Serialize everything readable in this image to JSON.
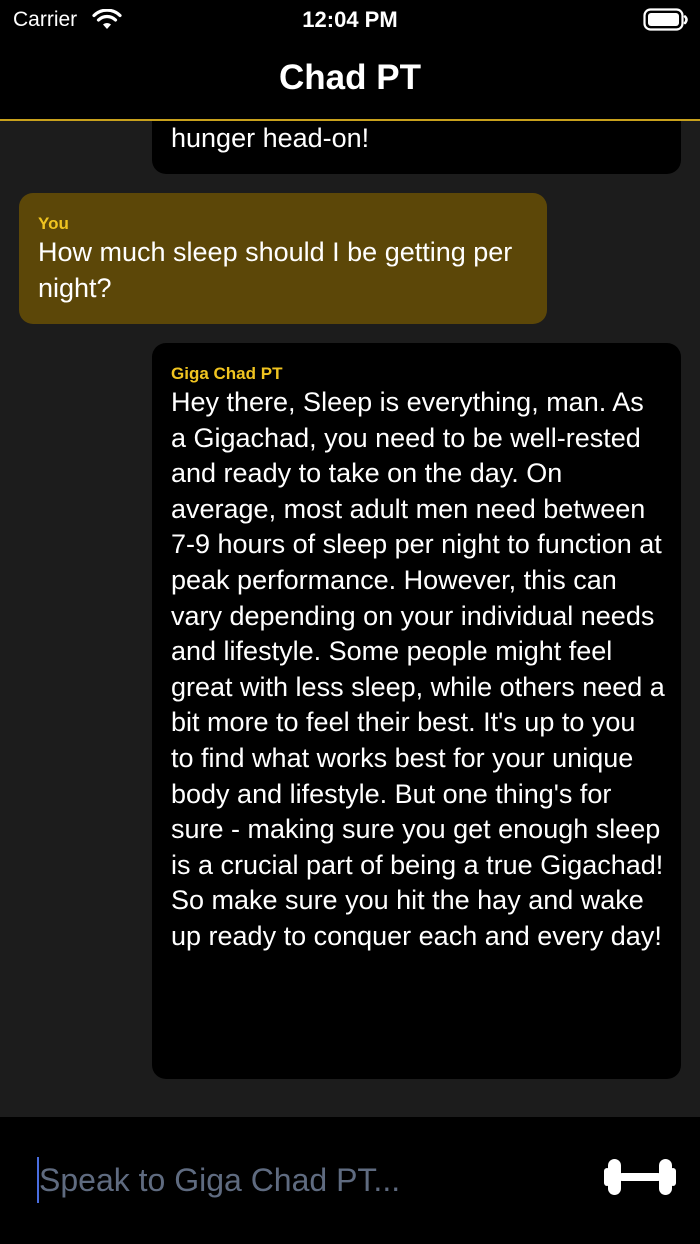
{
  "status_bar": {
    "carrier": "Carrier",
    "time": "12:04 PM",
    "icons": [
      "wifi-icon",
      "battery-icon"
    ]
  },
  "nav": {
    "title": "Chad PT"
  },
  "messages": [
    {
      "sender": "",
      "text": "hunger head-on!",
      "clipped": true
    },
    {
      "sender": "You",
      "text": "How much sleep should I be getting per night?"
    },
    {
      "sender": "Giga Chad PT",
      "text": "Hey there, Sleep is everything, man. As a Gigachad, you need to be well-rested and ready to take on the day. On average, most adult men need between 7-9 hours of sleep per night to function at peak performance. However, this can vary depending on your individual needs and lifestyle. Some people might feel great with less sleep, while others need a bit more to feel their best. It's up to you to find what works best for your unique body and lifestyle. But one thing's for sure - making sure you get enough sleep is a crucial part of being a true Gigachad! So make sure you hit the hay and wake up ready to conquer each and every day!"
    }
  ],
  "input": {
    "placeholder": "Speak to Giga Chad PT...",
    "value": ""
  },
  "send_button": {
    "icon": "dumbbell-icon"
  },
  "colors": {
    "accent": "#c8a11c",
    "sender_label": "#f0c420",
    "user_bubble": "#5c4708",
    "bot_bubble": "#000000",
    "background": "#1c1c1c"
  }
}
